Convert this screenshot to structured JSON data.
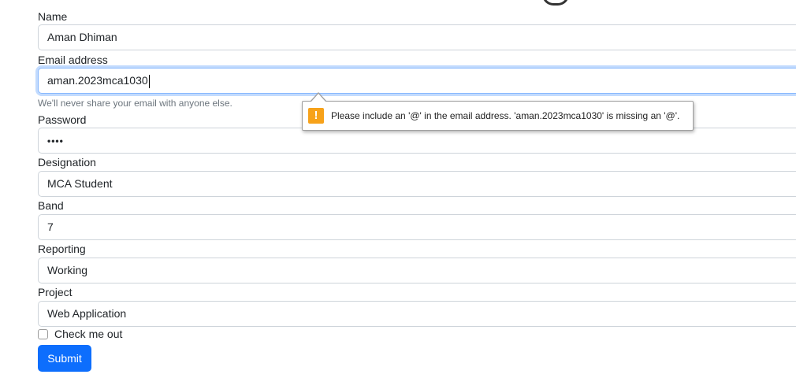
{
  "form": {
    "name": {
      "label": "Name",
      "value": "Aman Dhiman"
    },
    "email": {
      "label": "Email address",
      "value": "aman.2023mca1030",
      "help": "We'll never share your email with anyone else."
    },
    "password": {
      "label": "Password",
      "value": "••••"
    },
    "designation": {
      "label": "Designation",
      "value": "MCA Student"
    },
    "band": {
      "label": "Band",
      "value": "7"
    },
    "reporting": {
      "label": "Reporting",
      "value": "Working"
    },
    "project": {
      "label": "Project",
      "value": "Web Application"
    },
    "checkbox": {
      "label": "Check me out",
      "checked": false
    },
    "submit_label": "Submit"
  },
  "validation": {
    "message": "Please include an '@' in the email address. 'aman.2023mca1030' is missing an '@'.",
    "icon": "warning-icon",
    "icon_glyph": "!"
  },
  "colors": {
    "primary": "#0d6efd",
    "focus_border": "#86b7fe",
    "warning": "#f7a21a",
    "help_text": "#6c757d"
  }
}
